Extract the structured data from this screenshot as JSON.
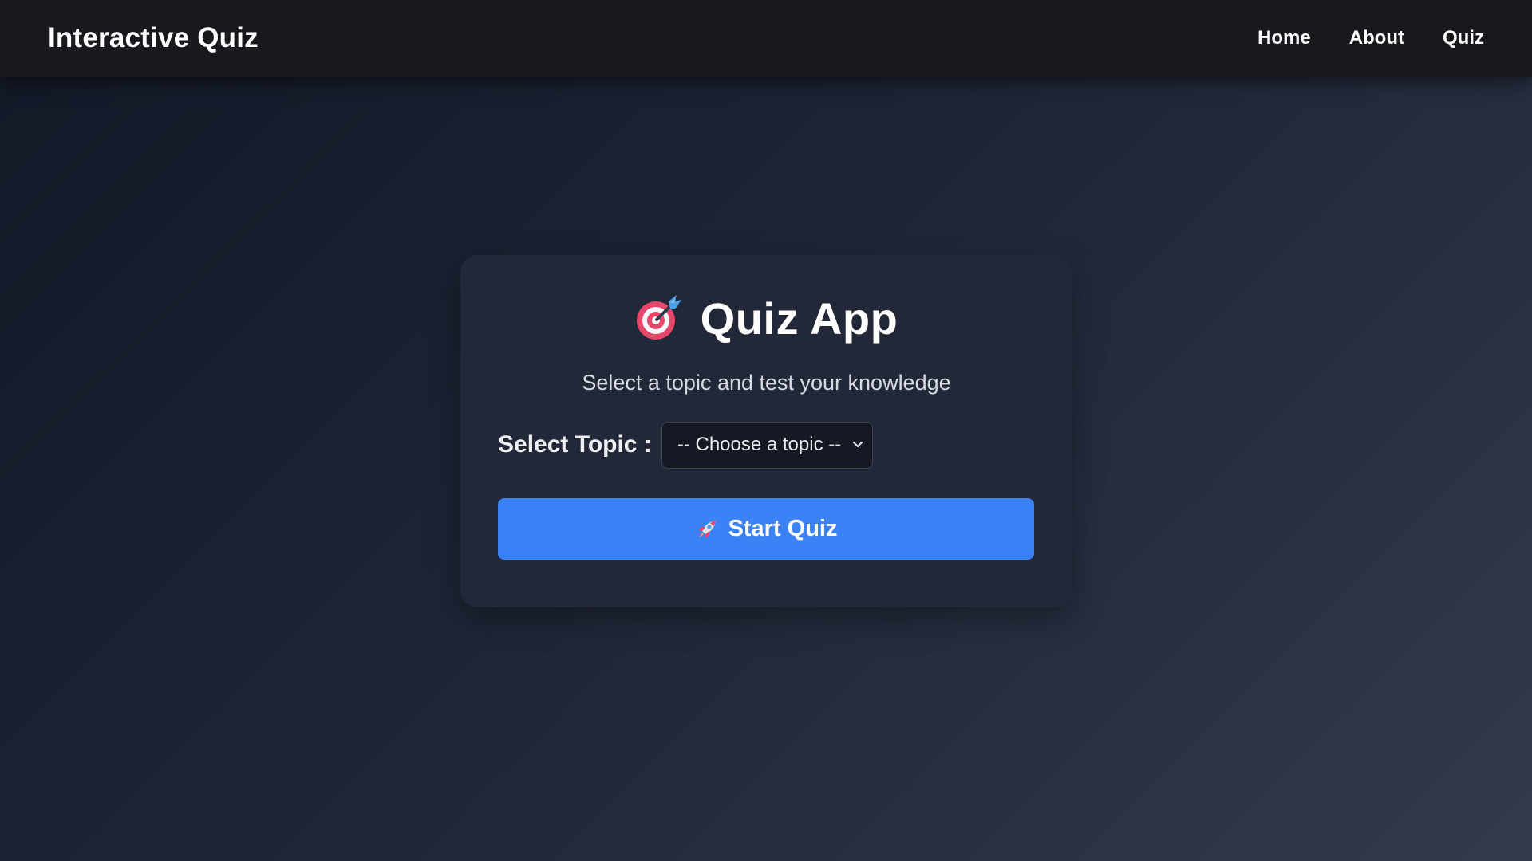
{
  "navbar": {
    "brand": "Interactive Quiz",
    "links": [
      {
        "label": "Home"
      },
      {
        "label": "About"
      },
      {
        "label": "Quiz"
      }
    ]
  },
  "card": {
    "title_icon": "target-dart-icon",
    "title": "Quiz App",
    "subtitle": "Select a topic and test your knowledge",
    "topic_label": "Select Topic :",
    "topic_select": {
      "selected": "-- Choose a topic --",
      "icon": "chevron-down-icon"
    },
    "start_button": {
      "icon": "rocket-icon",
      "label": "Start Quiz"
    }
  },
  "colors": {
    "navbar_bg": "#18191c",
    "card_bg": "#222837",
    "accent": "#3b82f6",
    "select_bg": "#141924"
  }
}
